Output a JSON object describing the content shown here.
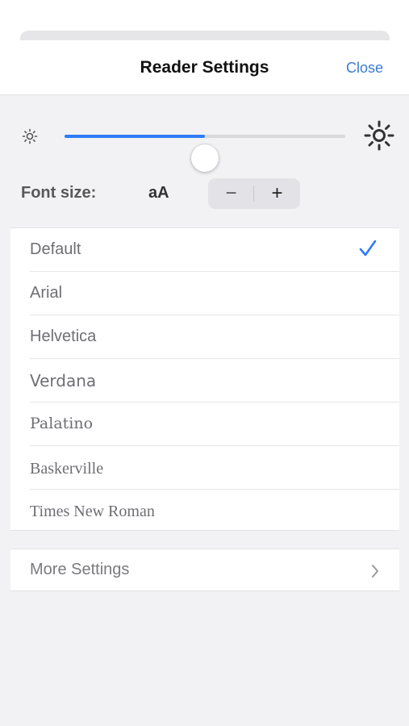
{
  "header": {
    "title": "Reader Settings",
    "close_label": "Close"
  },
  "brightness": {
    "level": 0.5
  },
  "font_size": {
    "label": "Font size:",
    "sample": "aA",
    "decrease": "−",
    "increase": "+"
  },
  "fonts": {
    "selected": "Default",
    "items": [
      {
        "label": "Default"
      },
      {
        "label": "Arial"
      },
      {
        "label": "Helvetica"
      },
      {
        "label": "Verdana"
      },
      {
        "label": "Palatino"
      },
      {
        "label": "Baskerville"
      },
      {
        "label": "Times New Roman"
      }
    ]
  },
  "more_settings": {
    "label": "More Settings"
  },
  "colors": {
    "accent": "#2f7cf6",
    "link": "#3a7bd5",
    "background": "#f2f2f4"
  }
}
